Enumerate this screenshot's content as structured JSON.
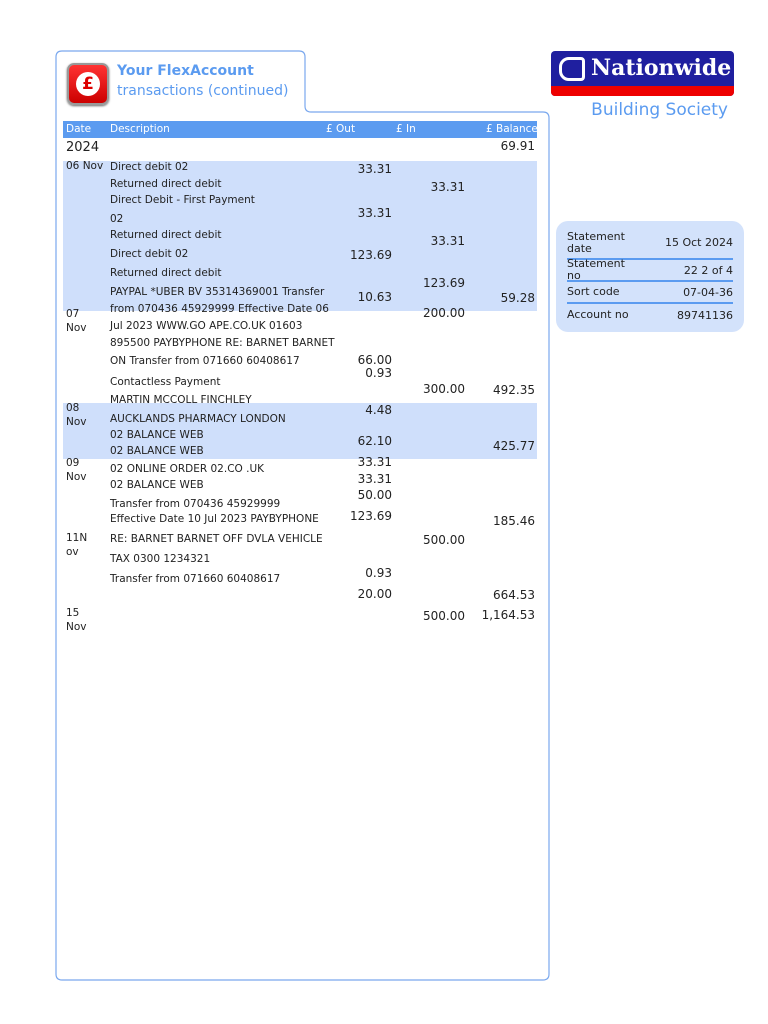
{
  "header": {
    "title_line1": "Your FlexAccount",
    "title_line2": "transactions (continued)",
    "icon": "pound-icon"
  },
  "brand": {
    "name": "Nationwide",
    "subtitle": "Building Society",
    "colors": {
      "navy": "#1f1f9f",
      "red": "#ee0000",
      "accent": "#5b9bf0"
    }
  },
  "info": [
    {
      "label": "Statement date",
      "value": "15 Oct 2024"
    },
    {
      "label": "Statement no",
      "value": "22 2 of 4"
    },
    {
      "label": "Sort code",
      "value": "07-04-36"
    },
    {
      "label": "Account no",
      "value": "89741136"
    }
  ],
  "table": {
    "headers": {
      "date": "Date",
      "description": "Description",
      "out": "£ Out",
      "in": "£ In",
      "balance": "£ Balance"
    },
    "year": "2024",
    "opening_balance": "69.91",
    "dates": [
      "06 Nov",
      "07",
      "Nov",
      "08",
      "Nov",
      "09",
      "Nov",
      "11N",
      "ov",
      "15",
      "Nov"
    ],
    "descriptions": [
      "Direct debit 02",
      "Returned direct debit",
      "Direct Debit - First Payment",
      "02",
      "Returned direct debit",
      "Direct debit 02",
      "Returned direct debit",
      "PAYPAL *UBER BV 35314369001 Transfer",
      "from 070436 45929999 Effective Date 06",
      "Jul 2023 WWW.GO APE.CO.UK 01603",
      "895500 PAYBYPHONE RE: BARNET BARNET",
      "ON Transfer from 071660 60408617",
      "Contactless Payment",
      "MARTIN MCCOLL FINCHLEY",
      "AUCKLANDS PHARMACY LONDON",
      "02 BALANCE WEB",
      "02 BALANCE WEB",
      "02 ONLINE ORDER 02.CO .UK",
      "02 BALANCE WEB",
      "Transfer from 070436 45929999",
      "Effective Date 10 Jul 2023 PAYBYPHONE",
      "RE: BARNET BARNET OFF DVLA VEHICLE",
      "TAX 0300 1234321",
      "Transfer from 071660 60408617"
    ],
    "out": [
      "33.31",
      "33.31",
      "123.69",
      "10.63",
      "66.00",
      "0.93",
      "4.48",
      "62.10",
      "33.31",
      "33.31",
      "50.00",
      "123.69",
      "0.93",
      "20.00"
    ],
    "in": [
      "33.31",
      "33.31",
      "123.69",
      "200.00",
      "300.00",
      "500.00",
      "500.00"
    ],
    "balance": [
      "59.28",
      "492.35",
      "425.77",
      "185.46",
      "664.53",
      "1,164.53"
    ]
  }
}
